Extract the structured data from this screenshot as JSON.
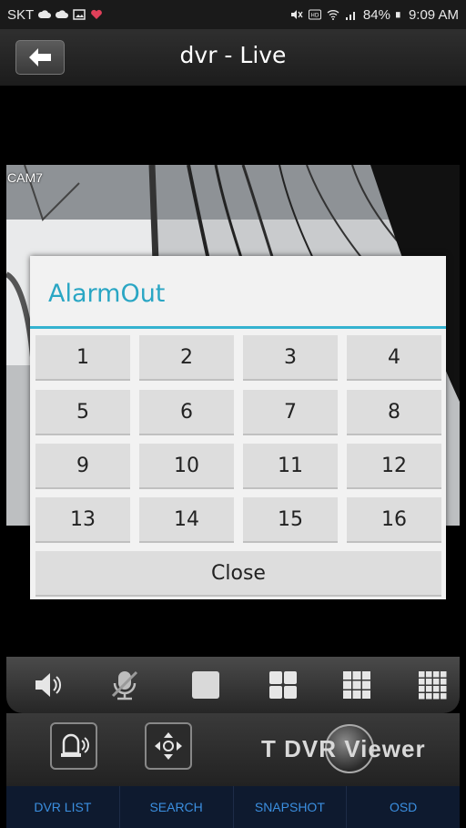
{
  "status_bar": {
    "carrier": "SKT",
    "battery": "84%",
    "time": "9:09 AM",
    "icons": [
      "cloud-icon",
      "cloud-icon",
      "image-icon",
      "heart-icon",
      "mute-icon",
      "volte-icon",
      "wifi-icon",
      "signal-icon",
      "battery-icon"
    ]
  },
  "header": {
    "title": "dvr - Live",
    "back_icon": "arrow-left-icon"
  },
  "video": {
    "camera_label": "CAM7"
  },
  "dialog": {
    "title": "AlarmOut",
    "buttons": [
      "1",
      "2",
      "3",
      "4",
      "5",
      "6",
      "7",
      "8",
      "9",
      "10",
      "11",
      "12",
      "13",
      "14",
      "15",
      "16"
    ],
    "close_label": "Close",
    "accent": "#35b3d0"
  },
  "controls": {
    "icons": [
      "speaker-icon",
      "mic-off-icon",
      "single-view-icon",
      "grid-2x2-icon",
      "grid-3x3-icon",
      "grid-4x4-icon"
    ]
  },
  "lower_panel": {
    "buttons": [
      "alarm-light-icon",
      "ptz-move-icon"
    ],
    "brand": "T DVR Viewer"
  },
  "bottom_nav": {
    "items": [
      "DVR LIST",
      "SEARCH",
      "SNAPSHOT",
      "OSD"
    ]
  }
}
